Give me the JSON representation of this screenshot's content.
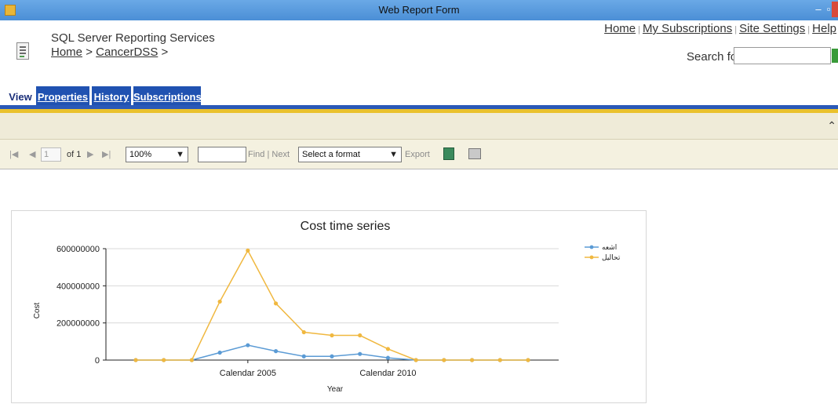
{
  "window": {
    "title": "Web Report Form"
  },
  "header": {
    "app_name": "SQL Server Reporting Services",
    "breadcrumb": {
      "home": "Home",
      "sep1": ">",
      "folder": "CancerDSS",
      "sep2": ">"
    },
    "toplinks": [
      "Home",
      "My Subscriptions",
      "Site Settings",
      "Help"
    ],
    "search_label": "Search for:"
  },
  "tabs": [
    "View",
    "Properties",
    "History",
    "Subscriptions"
  ],
  "toolbar": {
    "page_value": "1",
    "page_of": "of 1",
    "zoom": "100%",
    "find": "Find",
    "next": "Next",
    "format_placeholder": "Select a format",
    "export": "Export"
  },
  "chart_data": {
    "type": "line",
    "title": "Cost time series",
    "xlabel": "Year",
    "ylabel": "Cost",
    "ylim": [
      0,
      600000000
    ],
    "yticks": [
      0,
      200000000,
      400000000,
      600000000
    ],
    "ytick_labels": [
      "0",
      "200000000",
      "400000000",
      "600000000"
    ],
    "x_tick_labels": [
      {
        "index": 4,
        "label": "Calendar 2005"
      },
      {
        "index": 9,
        "label": "Calendar 2010"
      }
    ],
    "x": [
      0,
      1,
      2,
      3,
      4,
      5,
      6,
      7,
      8,
      9,
      10,
      11,
      12,
      13,
      14
    ],
    "series": [
      {
        "name": "اشعه",
        "color": "#5b9bd5",
        "values": [
          0,
          0,
          0,
          40000000,
          80000000,
          48000000,
          20000000,
          20000000,
          33000000,
          12000000,
          0,
          0,
          0,
          0,
          0
        ]
      },
      {
        "name": "تحالیل",
        "color": "#f0b840",
        "values": [
          0,
          0,
          0,
          315000000,
          590000000,
          305000000,
          150000000,
          133000000,
          133000000,
          60000000,
          0,
          0,
          0,
          0,
          0
        ]
      }
    ],
    "grid": true,
    "legend": "top-right"
  }
}
